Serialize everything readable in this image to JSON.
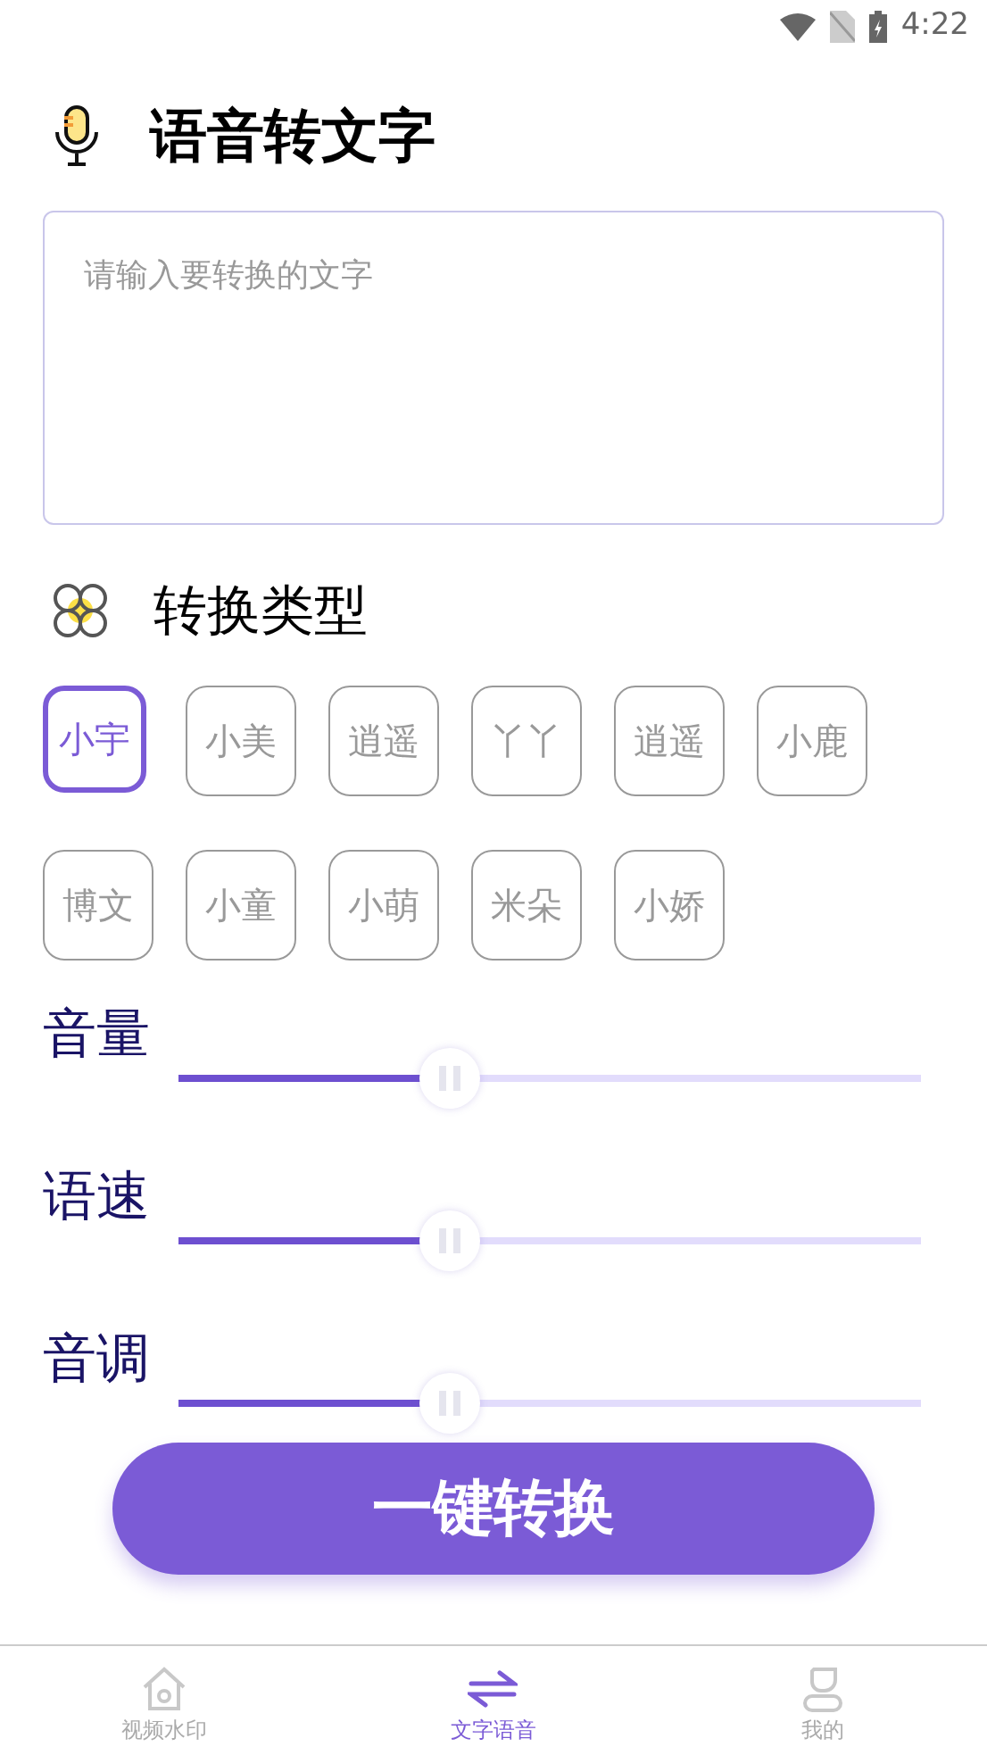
{
  "status_bar": {
    "time": "4:22"
  },
  "header": {
    "title": "语音转文字"
  },
  "text_input": {
    "placeholder": "请输入要转换的文字"
  },
  "type_section": {
    "title": "转换类型"
  },
  "voices": [
    {
      "label": "小宇",
      "selected": true
    },
    {
      "label": "小美",
      "selected": false
    },
    {
      "label": "逍遥",
      "selected": false
    },
    {
      "label": "丫丫",
      "selected": false
    },
    {
      "label": "逍遥",
      "selected": false
    },
    {
      "label": "小鹿",
      "selected": false
    },
    {
      "label": "博文",
      "selected": false
    },
    {
      "label": "小童",
      "selected": false
    },
    {
      "label": "小萌",
      "selected": false
    },
    {
      "label": "米朵",
      "selected": false
    },
    {
      "label": "小娇",
      "selected": false
    }
  ],
  "sliders": [
    {
      "label": "音量",
      "level": 0.33
    },
    {
      "label": "语速",
      "level": 0.33
    },
    {
      "label": "音调",
      "level": 0.33
    }
  ],
  "convert_button": "一键转换",
  "bottom_nav": [
    {
      "label": "视频水印",
      "kind": "home",
      "selected": false
    },
    {
      "label": "文字语音",
      "kind": "swap",
      "selected": true
    },
    {
      "label": "我的",
      "kind": "profile",
      "selected": false
    }
  ]
}
